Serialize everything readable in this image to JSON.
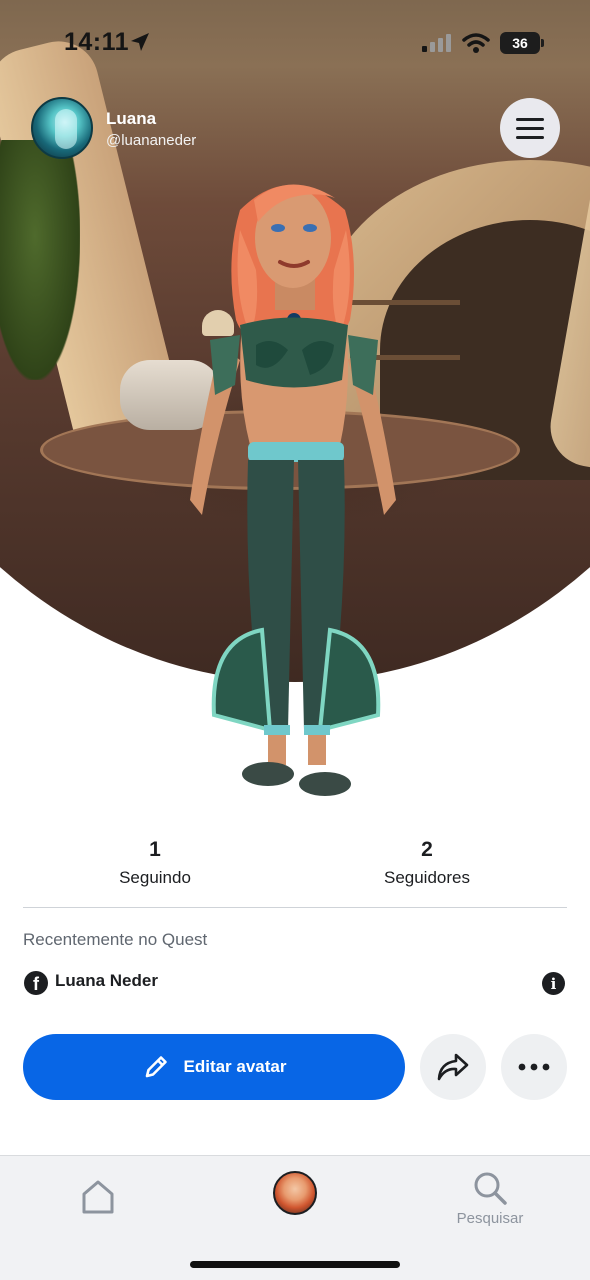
{
  "status_bar": {
    "time": "14:11",
    "battery": "36"
  },
  "profile": {
    "name": "Luana",
    "handle": "@luananeder"
  },
  "stats": [
    {
      "value": "1",
      "label": "Seguindo"
    },
    {
      "value": "2",
      "label": "Seguidores"
    }
  ],
  "recent": {
    "title": "Recentemente no Quest",
    "account_name": "Luana Neder"
  },
  "actions": {
    "edit_label": "Editar avatar"
  },
  "nav": {
    "search_label": "Pesquisar"
  },
  "colors": {
    "primary": "#0866e6",
    "text": "#1c1e21",
    "muted": "#606770",
    "nav_bg": "#f1f2f4"
  },
  "icons": [
    "location-arrow-icon",
    "signal-icon",
    "wifi-icon",
    "battery-icon",
    "menu-icon",
    "facebook-icon",
    "info-icon",
    "pencil-icon",
    "share-icon",
    "more-icon",
    "home-icon",
    "search-icon"
  ]
}
